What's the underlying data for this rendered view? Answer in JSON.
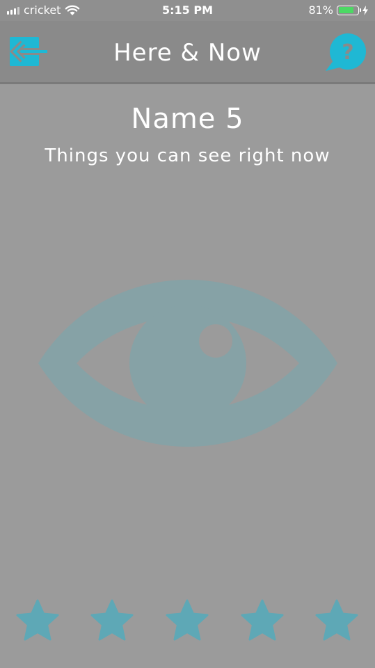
{
  "status_bar": {
    "carrier": "cricket",
    "time": "5:15 PM",
    "battery_percent": "81%",
    "battery_level": 0.81
  },
  "nav": {
    "title": "Here & Now",
    "back_icon": "exit-arrow-icon",
    "help_icon": "help-bubble-icon",
    "help_glyph": "?"
  },
  "content": {
    "heading": "Name 5",
    "subheading": "Things you can see right now",
    "illustration": "eye-icon"
  },
  "progress": {
    "stars_total": 5,
    "stars_filled": 0,
    "star_icon": "star-icon"
  },
  "colors": {
    "accent": "#1fb8d4",
    "background": "#9b9b9b",
    "nav_background": "#8a8a8a",
    "eye": "#86a2a6",
    "star": "#5ea8b6"
  }
}
